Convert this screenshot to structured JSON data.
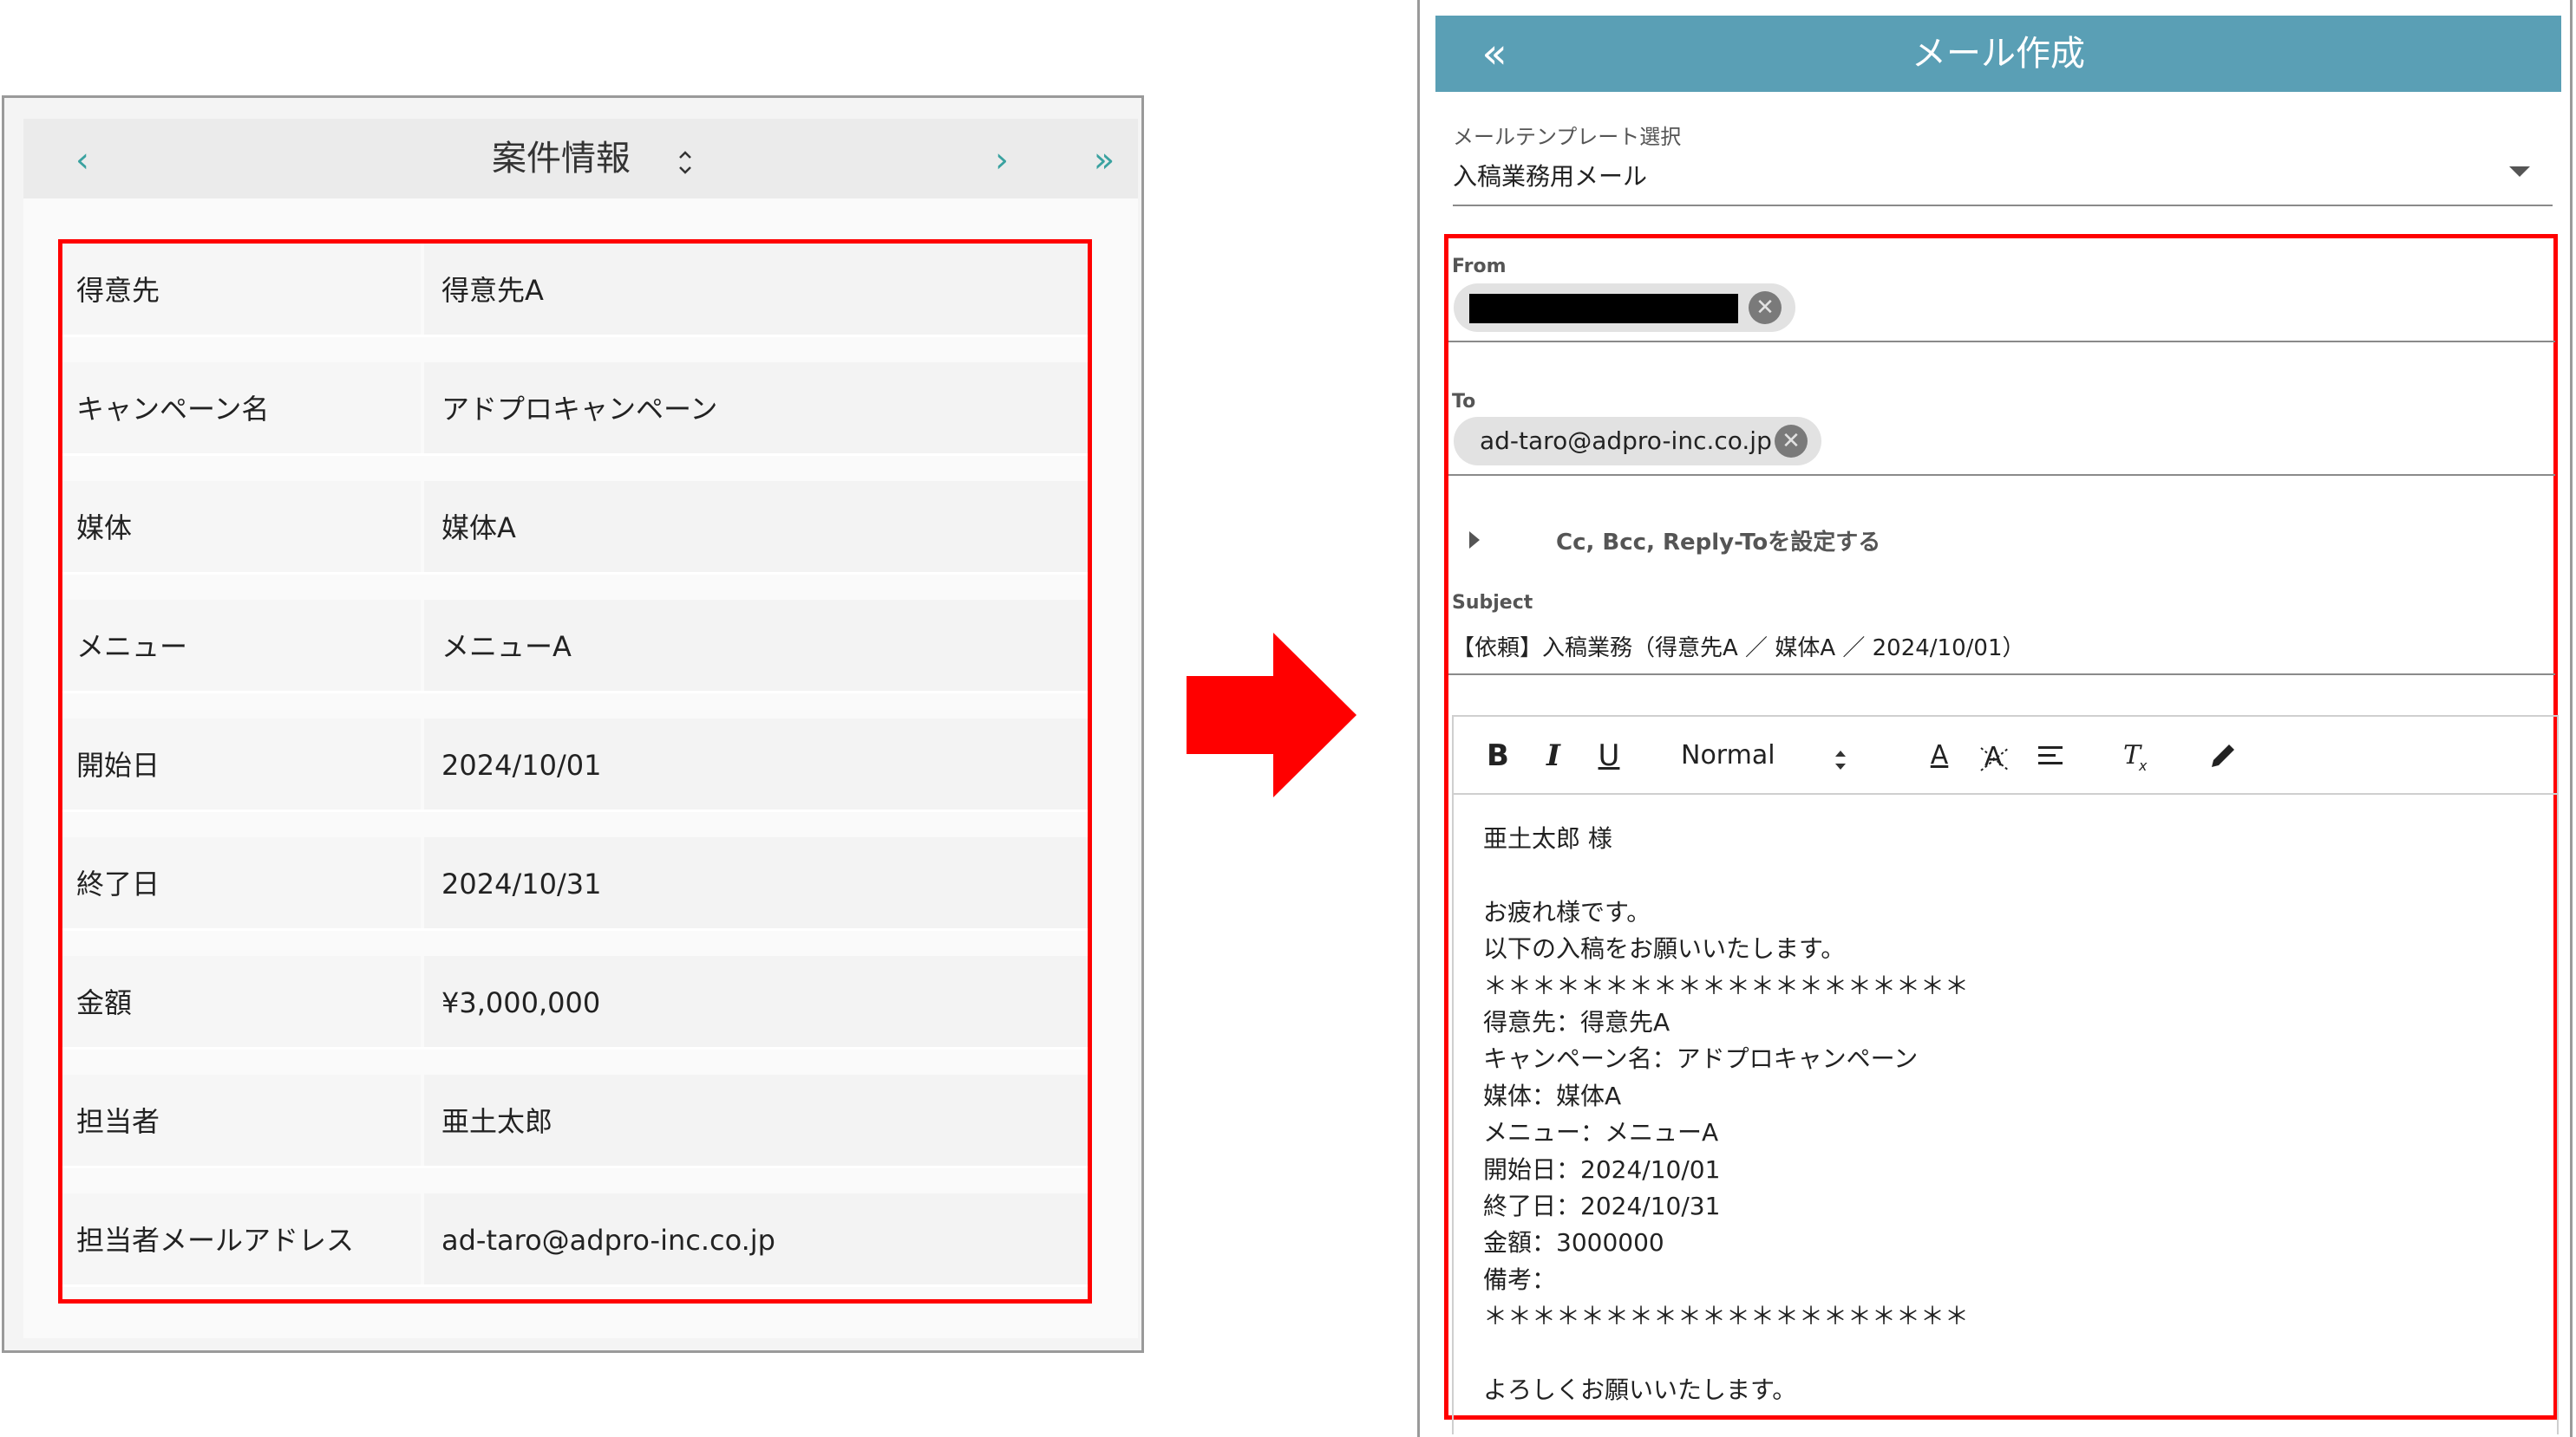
{
  "case_info": {
    "title": "案件情報",
    "nav": {
      "prev": "‹",
      "next": "›",
      "last": "»",
      "sort": "⌃⌄"
    },
    "rows": [
      {
        "label": "得意先",
        "value": "得意先A"
      },
      {
        "label": "キャンペーン名",
        "value": "アドプロキャンペーン"
      },
      {
        "label": "媒体",
        "value": "媒体A"
      },
      {
        "label": "メニュー",
        "value": "メニューA"
      },
      {
        "label": "開始日",
        "value": "2024/10/01"
      },
      {
        "label": "終了日",
        "value": "2024/10/31"
      },
      {
        "label": "金額",
        "value": "¥3,000,000"
      },
      {
        "label": "担当者",
        "value": "亜土太郎"
      },
      {
        "label": "担当者メールアドレス",
        "value": "ad-taro@adpro-inc.co.jp"
      }
    ]
  },
  "mail": {
    "title": "メール作成",
    "back": "«",
    "template": {
      "label": "メールテンプレート選択",
      "value": "入稿業務用メール"
    },
    "from": {
      "label": "From",
      "chip_close": "✕"
    },
    "to": {
      "label": "To",
      "chip_text": "ad-taro@adpro-inc.co.jp",
      "chip_close": "✕"
    },
    "cc_toggle": "Cc, Bcc, Reply-Toを設定する",
    "subject": {
      "label": "Subject",
      "value": "【依頼】入稿業務（得意先A ／ 媒体A ／ 2024/10/01）"
    },
    "toolbar": {
      "bold": "B",
      "italic": "I",
      "underline": "U",
      "size": "Normal",
      "size_arrows": "⬍",
      "text_color": "A",
      "bg_color": "A",
      "align": "≡",
      "clear_format": "Tx",
      "pen": "✎"
    },
    "body_lines": [
      "亜土太郎 様",
      "",
      "お疲れ様です。",
      "以下の入稿をお願いいたします。",
      "＊＊＊＊＊＊＊＊＊＊＊＊＊＊＊＊＊＊＊＊",
      "得意先：得意先A",
      "キャンペーン名：アドプロキャンペーン",
      "媒体：媒体A",
      "メニュー：メニューA",
      "開始日：2024/10/01",
      "終了日：2024/10/31",
      "金額：3000000",
      "備考：",
      "＊＊＊＊＊＊＊＊＊＊＊＊＊＊＊＊＊＊＊＊",
      "",
      "よろしくお願いいたします。"
    ]
  },
  "colors": {
    "accent_teal": "#3aa2a0",
    "header_blue": "#5a9fb5",
    "highlight_red": "#ff0000"
  }
}
